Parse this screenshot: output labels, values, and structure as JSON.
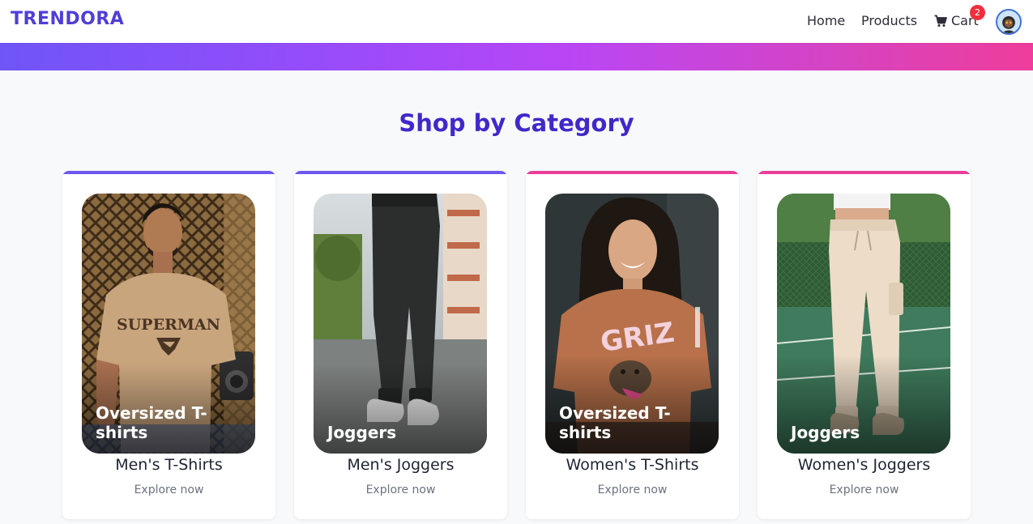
{
  "nav": {
    "brand": "TRENDORA",
    "home": "Home",
    "products": "Products",
    "cart": "Cart",
    "cart_count": "2"
  },
  "section": {
    "title": "Shop by Category"
  },
  "categories": [
    {
      "image_label": "Oversized T-shirts",
      "title": "Men's T-Shirts",
      "cta": "Explore now",
      "accent": "#6e56ee"
    },
    {
      "image_label": "Joggers",
      "title": "Men's Joggers",
      "cta": "Explore now",
      "accent": "#6e56ee"
    },
    {
      "image_label": "Oversized T-shirts",
      "title": "Women's T-Shirts",
      "cta": "Explore now",
      "accent": "#ea3d98"
    },
    {
      "image_label": "Joggers",
      "title": "Women's Joggers",
      "cta": "Explore now",
      "accent": "#ea3d98"
    }
  ],
  "colors": {
    "brand": "#4f3ed8",
    "title": "#4228c9",
    "badge": "#ef2f3e"
  },
  "icons": [
    "cart-icon",
    "avatar"
  ]
}
